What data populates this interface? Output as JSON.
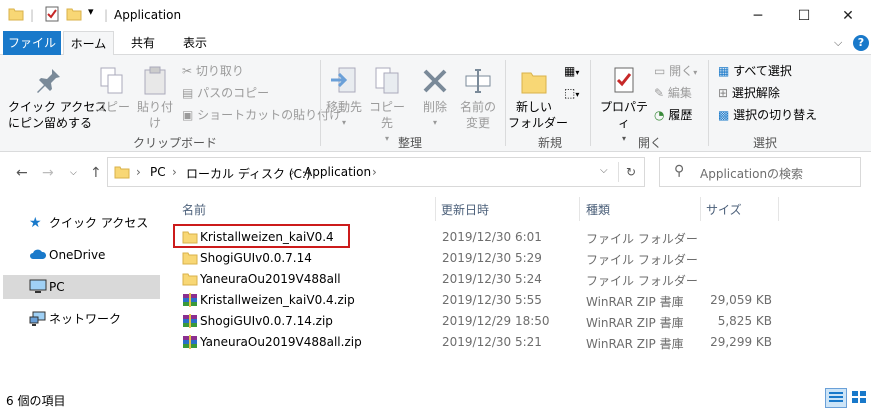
{
  "window": {
    "title": "Application"
  },
  "tabs": {
    "file": "ファイル",
    "home": "ホーム",
    "share": "共有",
    "view": "表示",
    "help": "?"
  },
  "ribbon": {
    "pin": "クイック アクセス\nにピン留めする",
    "copy": "コピー",
    "paste": "貼り付け",
    "cut": "切り取り",
    "copy_path": "パスのコピー",
    "paste_shortcut": "ショートカットの貼り付け",
    "group_clipboard": "クリップボード",
    "move_to": "移動先",
    "copy_to": "コピー先",
    "delete": "削除",
    "rename": "名前の\n変更",
    "group_organize": "整理",
    "new_folder": "新しい\nフォルダー",
    "group_new": "新規",
    "properties": "プロパティ",
    "open": "開く",
    "edit": "編集",
    "history": "履歴",
    "group_open": "開く",
    "select_all": "すべて選択",
    "select_none": "選択解除",
    "invert_selection": "選択の切り替え",
    "group_select": "選択"
  },
  "address": {
    "crumbs": [
      "PC",
      "ローカル ディスク (C:)",
      "Application"
    ],
    "search_placeholder": "Applicationの検索"
  },
  "nav": {
    "items": [
      {
        "label": "クイック アクセス"
      },
      {
        "label": "OneDrive"
      },
      {
        "label": "PC"
      },
      {
        "label": "ネットワーク"
      }
    ]
  },
  "columns": {
    "name": "名前",
    "date": "更新日時",
    "type": "種類",
    "size": "サイズ"
  },
  "files": [
    {
      "name": "Kristallweizen_kaiV0.4",
      "date": "2019/12/30 6:01",
      "type": "ファイル フォルダー",
      "size": "",
      "kind": "folder"
    },
    {
      "name": "ShogiGUIv0.0.7.14",
      "date": "2019/12/30 5:29",
      "type": "ファイル フォルダー",
      "size": "",
      "kind": "folder"
    },
    {
      "name": "YaneuraOu2019V488all",
      "date": "2019/12/30 5:24",
      "type": "ファイル フォルダー",
      "size": "",
      "kind": "folder"
    },
    {
      "name": "Kristallweizen_kaiV0.4.zip",
      "date": "2019/12/30 5:55",
      "type": "WinRAR ZIP 書庫",
      "size": "29,059 KB",
      "kind": "zip"
    },
    {
      "name": "ShogiGUIv0.0.7.14.zip",
      "date": "2019/12/29 18:50",
      "type": "WinRAR ZIP 書庫",
      "size": "5,825 KB",
      "kind": "zip"
    },
    {
      "name": "YaneuraOu2019V488all.zip",
      "date": "2019/12/30 5:21",
      "type": "WinRAR ZIP 書庫",
      "size": "29,299 KB",
      "kind": "zip"
    }
  ],
  "status": {
    "count": "6 個の項目"
  },
  "colors": {
    "accent": "#1979ca",
    "folder": "#f8d775",
    "highlight": "#cc1b1b"
  }
}
